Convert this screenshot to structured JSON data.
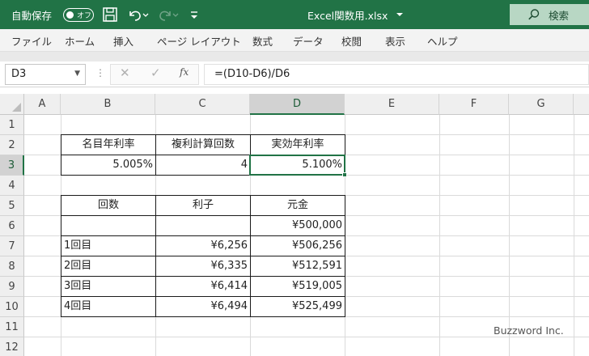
{
  "titlebar": {
    "autosave_label": "自動保存",
    "autosave_state": "オフ",
    "filename": "Excel関数用.xlsx",
    "search_label": "検索"
  },
  "ribbon": {
    "tabs": [
      "ファイル",
      "ホーム",
      "挿入",
      "ページ レイアウト",
      "数式",
      "データ",
      "校閲",
      "表示",
      "ヘルプ"
    ]
  },
  "formula_bar": {
    "name_box": "D3",
    "fx_label": "fx",
    "formula": "=(D10-D6)/D6"
  },
  "sheet": {
    "columns": [
      "A",
      "B",
      "C",
      "D",
      "E",
      "F",
      "G"
    ],
    "rows": [
      "1",
      "2",
      "3",
      "4",
      "5",
      "6",
      "7",
      "8",
      "9",
      "10",
      "11",
      "12"
    ],
    "selected_cell": "D3",
    "cells": {
      "B2": "名目年利率",
      "C2": "複利計算回数",
      "D2": "実効年利率",
      "B3": "5.005%",
      "C3": "4",
      "D3": "5.100%",
      "B5": "回数",
      "C5": "利子",
      "D5": "元金",
      "D6": "¥500,000",
      "B7": "1回目",
      "C7": "¥6,256",
      "D7": "¥506,256",
      "B8": "2回目",
      "C8": "¥6,335",
      "D8": "¥512,591",
      "B9": "3回目",
      "C9": "¥6,414",
      "D9": "¥519,005",
      "B10": "4回目",
      "C10": "¥6,494",
      "D10": "¥525,499"
    }
  },
  "watermark": "Buzzword Inc.",
  "colors": {
    "accent": "#217346",
    "header_bg": "#efefef",
    "selected_header_bg": "#d2d2d2"
  }
}
